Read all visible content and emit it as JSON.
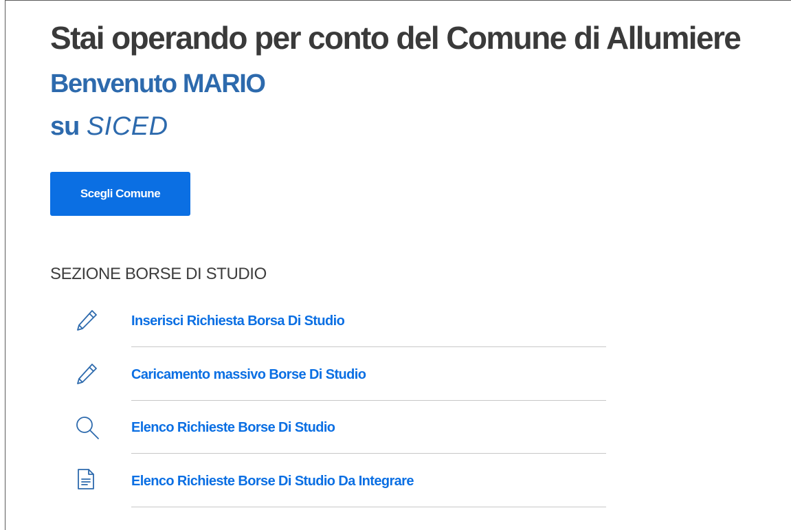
{
  "header": {
    "context_title": "Stai operando per conto del Comune di Allumiere",
    "welcome": "Benvenuto MARIO",
    "on_prefix": "su",
    "app_name": "SICED"
  },
  "actions": {
    "choose_municipality_label": "Scegli Comune"
  },
  "section": {
    "title": "SEZIONE BORSE DI STUDIO",
    "items": [
      {
        "icon": "pencil-icon",
        "label": "Inserisci Richiesta Borsa Di Studio"
      },
      {
        "icon": "pencil-icon",
        "label": "Caricamento massivo Borse Di Studio"
      },
      {
        "icon": "search-icon",
        "label": "Elenco Richieste Borse Di Studio"
      },
      {
        "icon": "document-icon",
        "label": "Elenco Richieste Borse Di Studio Da Integrare"
      }
    ]
  },
  "colors": {
    "primary": "#0b6fe3",
    "welcome_text": "#2d6aad",
    "heading_text": "#3a3a3a",
    "divider": "#c7c7c7"
  }
}
